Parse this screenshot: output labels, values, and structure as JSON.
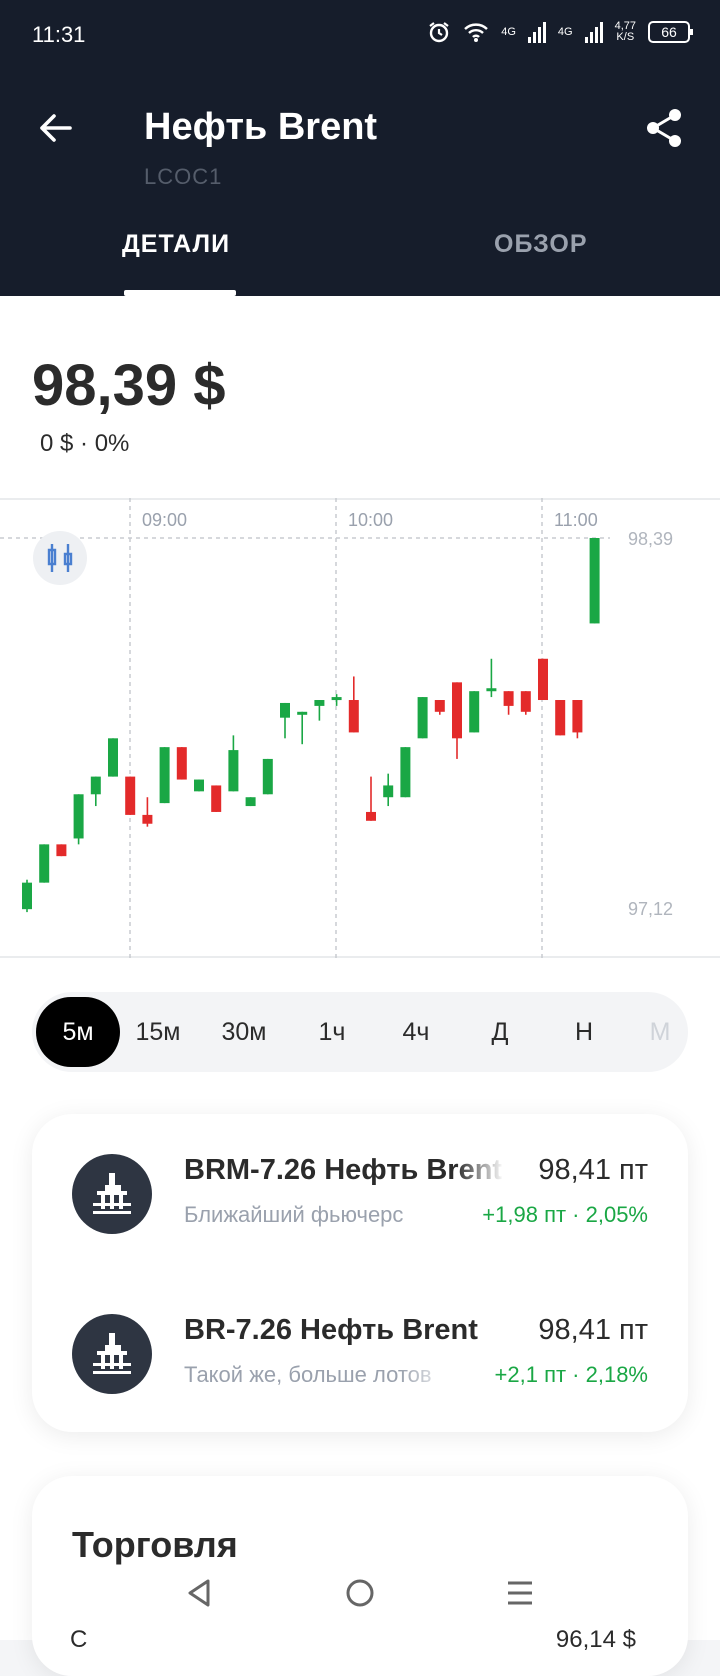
{
  "status_bar": {
    "time": "11:31",
    "net1": "4G",
    "net2": "4G",
    "speed_top": "4,77",
    "speed_unit": "K/S",
    "battery": "66"
  },
  "header": {
    "title": "Нефть Brent",
    "ticker": "LCOC1"
  },
  "tabs": [
    {
      "label": "ДЕТАЛИ",
      "selected": true
    },
    {
      "label": "ОБЗОР",
      "selected": false
    }
  ],
  "quote": {
    "price": "98,39 $",
    "change": "0 $ · 0%"
  },
  "colors": {
    "up": "#1aa745",
    "down": "#e32a2a",
    "header_bg": "#161d2b"
  },
  "chart_data": {
    "type": "candlestick",
    "x_labels": [
      "09:00",
      "10:00",
      "11:00"
    ],
    "y_labels": [
      "98,39",
      "97,12"
    ],
    "ylim": [
      97.1,
      98.39
    ],
    "grid": "dashed vertical at time labels",
    "candles": [
      {
        "o": 97.13,
        "h": 97.23,
        "l": 97.12,
        "c": 97.22
      },
      {
        "o": 97.22,
        "h": 97.35,
        "l": 97.22,
        "c": 97.35
      },
      {
        "o": 97.35,
        "h": 97.35,
        "l": 97.31,
        "c": 97.31
      },
      {
        "o": 97.37,
        "h": 97.52,
        "l": 97.35,
        "c": 97.52
      },
      {
        "o": 97.52,
        "h": 97.58,
        "l": 97.48,
        "c": 97.58
      },
      {
        "o": 97.58,
        "h": 97.71,
        "l": 97.58,
        "c": 97.71
      },
      {
        "o": 97.58,
        "h": 97.58,
        "l": 97.45,
        "c": 97.45
      },
      {
        "o": 97.45,
        "h": 97.51,
        "l": 97.41,
        "c": 97.42
      },
      {
        "o": 97.49,
        "h": 97.68,
        "l": 97.49,
        "c": 97.68
      },
      {
        "o": 97.68,
        "h": 97.68,
        "l": 97.57,
        "c": 97.57
      },
      {
        "o": 97.53,
        "h": 97.57,
        "l": 97.53,
        "c": 97.57
      },
      {
        "o": 97.55,
        "h": 97.55,
        "l": 97.46,
        "c": 97.46
      },
      {
        "o": 97.53,
        "h": 97.72,
        "l": 97.53,
        "c": 97.67
      },
      {
        "o": 97.48,
        "h": 97.51,
        "l": 97.48,
        "c": 97.51
      },
      {
        "o": 97.52,
        "h": 97.64,
        "l": 97.52,
        "c": 97.64
      },
      {
        "o": 97.78,
        "h": 97.79,
        "l": 97.71,
        "c": 97.83
      },
      {
        "o": 97.8,
        "h": 97.8,
        "l": 97.69,
        "c": 97.8
      },
      {
        "o": 97.82,
        "h": 97.84,
        "l": 97.77,
        "c": 97.84
      },
      {
        "o": 97.84,
        "h": 97.86,
        "l": 97.82,
        "c": 97.85
      },
      {
        "o": 97.84,
        "h": 97.92,
        "l": 97.84,
        "c": 97.73
      },
      {
        "o": 97.46,
        "h": 97.58,
        "l": 97.45,
        "c": 97.43
      },
      {
        "o": 97.51,
        "h": 97.59,
        "l": 97.48,
        "c": 97.55
      },
      {
        "o": 97.51,
        "h": 97.65,
        "l": 97.51,
        "c": 97.68
      },
      {
        "o": 97.71,
        "h": 97.85,
        "l": 97.71,
        "c": 97.85
      },
      {
        "o": 97.84,
        "h": 97.84,
        "l": 97.79,
        "c": 97.8
      },
      {
        "o": 97.9,
        "h": 97.9,
        "l": 97.64,
        "c": 97.71
      },
      {
        "o": 97.73,
        "h": 97.87,
        "l": 97.73,
        "c": 97.87
      },
      {
        "o": 97.87,
        "h": 97.98,
        "l": 97.85,
        "c": 97.88
      },
      {
        "o": 97.87,
        "h": 97.87,
        "l": 97.79,
        "c": 97.82
      },
      {
        "o": 97.87,
        "h": 97.87,
        "l": 97.79,
        "c": 97.8
      },
      {
        "o": 97.98,
        "h": 97.98,
        "l": 97.84,
        "c": 97.84
      },
      {
        "o": 97.84,
        "h": 97.84,
        "l": 97.72,
        "c": 97.72
      },
      {
        "o": 97.84,
        "h": 97.84,
        "l": 97.71,
        "c": 97.73
      },
      {
        "o": 98.1,
        "h": 98.39,
        "l": 98.1,
        "c": 98.39
      }
    ]
  },
  "timeframes": [
    {
      "label": "5м",
      "selected": true
    },
    {
      "label": "15м"
    },
    {
      "label": "30м"
    },
    {
      "label": "1ч"
    },
    {
      "label": "4ч"
    },
    {
      "label": "Д"
    },
    {
      "label": "Н"
    },
    {
      "label": "М"
    }
  ],
  "futures": [
    {
      "name": "BRM-7.26 Нефть Brent",
      "price": "98,41 пт",
      "subtitle": "Ближайший фьючерс",
      "change": "+1,98 пт · 2,05%"
    },
    {
      "name": "BR-7.26 Нефть Brent",
      "price": "98,41 пт",
      "subtitle": "Такой же, больше лотов",
      "change": "+2,1 пт · 2,18%"
    }
  ],
  "trading": {
    "title": "Торговля",
    "peek_left": "С",
    "peek_right": "96,14 $"
  }
}
